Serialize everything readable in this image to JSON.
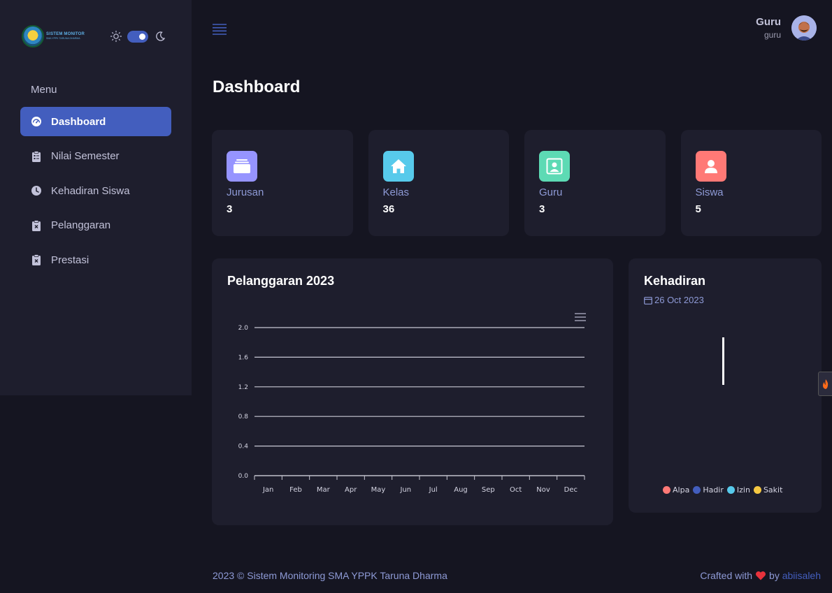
{
  "brand": {
    "line1": "SISTEM MONITOR",
    "line2": "SMA YPPK TARUNA DHARMA"
  },
  "sidebar": {
    "menu_title": "Menu",
    "items": [
      {
        "label": "Dashboard",
        "icon": "dashboard-icon",
        "active": true
      },
      {
        "label": "Nilai Semester",
        "icon": "clipboard-icon",
        "active": false
      },
      {
        "label": "Kehadiran Siswa",
        "icon": "clock-icon",
        "active": false
      },
      {
        "label": "Pelanggaran",
        "icon": "clipboard-x-icon",
        "active": false
      },
      {
        "label": "Prestasi",
        "icon": "clipboard-x-icon",
        "active": false
      }
    ]
  },
  "user": {
    "name": "Guru",
    "role": "guru"
  },
  "page": {
    "title": "Dashboard"
  },
  "stats": [
    {
      "label": "Jurusan",
      "value": "3",
      "color": "#9694ff",
      "icon": "stack-icon"
    },
    {
      "label": "Kelas",
      "value": "36",
      "color": "#57caeb",
      "icon": "house-icon"
    },
    {
      "label": "Guru",
      "value": "3",
      "color": "#5ddab4",
      "icon": "person-board-icon"
    },
    {
      "label": "Siswa",
      "value": "5",
      "color": "#ff7976",
      "icon": "person-icon"
    }
  ],
  "pelanggaran": {
    "title": "Pelanggaran 2023"
  },
  "chart_data": {
    "type": "line",
    "title": "Pelanggaran 2023",
    "categories": [
      "Jan",
      "Feb",
      "Mar",
      "Apr",
      "May",
      "Jun",
      "Jul",
      "Aug",
      "Sep",
      "Oct",
      "Nov",
      "Dec"
    ],
    "y_ticks": [
      "0.0",
      "0.4",
      "0.8",
      "1.2",
      "1.6",
      "2.0"
    ],
    "ylim": [
      0,
      2
    ],
    "series": [],
    "grid": true
  },
  "kehadiran": {
    "title": "Kehadiran",
    "date": "26 Oct 2023",
    "legend": [
      {
        "label": "Alpa",
        "color": "#ff7976"
      },
      {
        "label": "Hadir",
        "color": "#435ebe"
      },
      {
        "label": "Izin",
        "color": "#57caeb"
      },
      {
        "label": "Sakit",
        "color": "#f5c842"
      }
    ]
  },
  "footer": {
    "left": "2023 © Sistem Monitoring SMA YPPK Taruna Dharma",
    "crafted": "Crafted with",
    "by": "by",
    "author": "abiisaleh"
  },
  "colors": {
    "accent": "#435ebe",
    "background": "#151521",
    "card": "#1e1e2d"
  }
}
